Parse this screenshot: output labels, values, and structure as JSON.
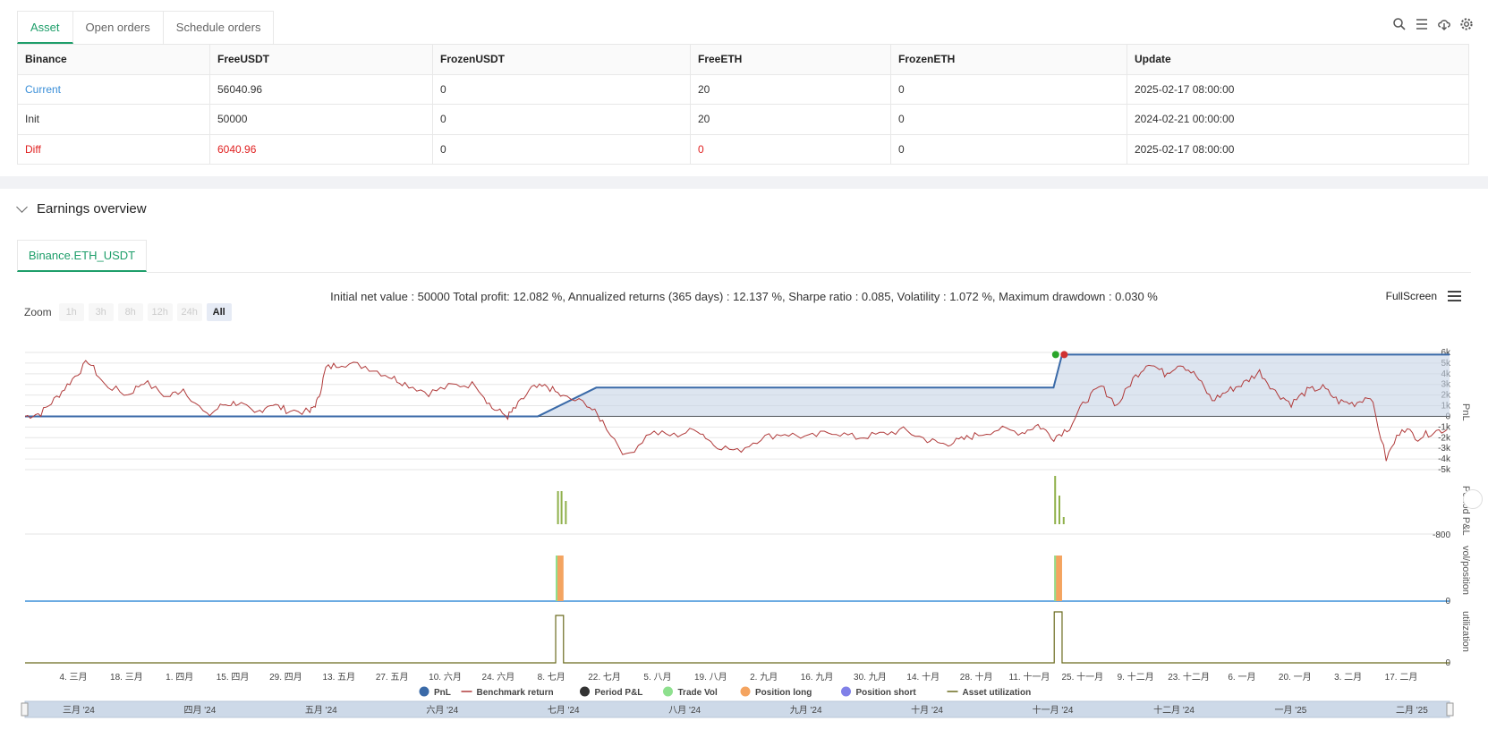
{
  "tabs": [
    "Asset",
    "Open orders",
    "Schedule orders"
  ],
  "toolbar_icons": [
    "search-icon",
    "list-icon",
    "cloud-download-icon",
    "gear-icon"
  ],
  "asset_table": {
    "headers": [
      "Binance",
      "FreeUSDT",
      "FrozenUSDT",
      "FreeETH",
      "FrozenETH",
      "Update"
    ],
    "rows": [
      {
        "label": "Current",
        "free_usdt": "56040.96",
        "frozen_usdt": "0",
        "free_eth": "20",
        "frozen_eth": "0",
        "update": "2025-02-17 08:00:00"
      },
      {
        "label": "Init",
        "free_usdt": "50000",
        "frozen_usdt": "0",
        "free_eth": "20",
        "frozen_eth": "0",
        "update": "2024-02-21 00:00:00"
      },
      {
        "label": "Diff",
        "free_usdt": "6040.96",
        "frozen_usdt": "0",
        "free_eth": "0",
        "frozen_eth": "0",
        "update": "2025-02-17 08:00:00"
      }
    ],
    "colors": {
      "current": "#3b8fd8",
      "diff": "#e02020"
    }
  },
  "overview": {
    "title": "Earnings overview",
    "subtab": "Binance.ETH_USDT",
    "stats": "Initial net value : 50000 Total profit: 12.082 %, Annualized returns (365 days) : 12.137 %, Sharpe ratio : 0.085, Volatility : 1.072 %, Maximum drawdown : 0.030 %",
    "fullscreen": "FullScreen",
    "zoom_label": "Zoom",
    "zoom_options": [
      "1h",
      "3h",
      "8h",
      "12h",
      "24h",
      "All"
    ],
    "zoom_selected": "All"
  },
  "chart_data": {
    "type": "line",
    "x_ticks": [
      "4. 三月",
      "18. 三月",
      "1. 四月",
      "15. 四月",
      "29. 四月",
      "13. 五月",
      "27. 五月",
      "10. 六月",
      "24. 六月",
      "8. 七月",
      "22. 七月",
      "5. 八月",
      "19. 八月",
      "2. 九月",
      "16. 九月",
      "30. 九月",
      "14. 十月",
      "28. 十月",
      "11. 十一月",
      "25. 十一月",
      "9. 十二月",
      "23. 十二月",
      "6. 一月",
      "20. 一月",
      "3. 二月",
      "17. 二月"
    ],
    "navigator_ticks": [
      "三月 '24",
      "四月 '24",
      "五月 '24",
      "六月 '24",
      "七月 '24",
      "八月 '24",
      "九月 '24",
      "十月 '24",
      "十一月 '24",
      "十二月 '24",
      "一月 '25",
      "二月 '25"
    ],
    "pnl_axis": {
      "title": "PnL",
      "ticks": [
        "6k",
        "5k",
        "4k",
        "3k",
        "2k",
        "1k",
        "0",
        "-1k",
        "-2k",
        "-3k",
        "-4k",
        "-5k"
      ],
      "ylim": [
        -5000,
        6000
      ]
    },
    "period_axis": {
      "title": "Period P&L",
      "ticks": [
        "-800"
      ]
    },
    "vol_axis": {
      "title": "vol/position",
      "ticks": [
        "0"
      ]
    },
    "util_axis": {
      "title": "utilization",
      "ticks": [
        "0"
      ]
    },
    "series": [
      {
        "name": "PnL",
        "color": "#3a6aa8",
        "points": [
          [
            0,
            0
          ],
          [
            0.36,
            0
          ],
          [
            0.401,
            2700
          ],
          [
            0.722,
            2700
          ],
          [
            0.728,
            5800
          ],
          [
            1,
            5800
          ]
        ]
      },
      {
        "name": "Benchmark return",
        "color": "#b03a3a"
      },
      {
        "name": "Period P&L",
        "color": "#333333"
      },
      {
        "name": "Trade Vol",
        "color": "#8ee08e"
      },
      {
        "name": "Position long",
        "color": "#f4a460"
      },
      {
        "name": "Position short",
        "color": "#8080e8"
      },
      {
        "name": "Asset utilization",
        "color": "#6b6b1f"
      }
    ]
  }
}
